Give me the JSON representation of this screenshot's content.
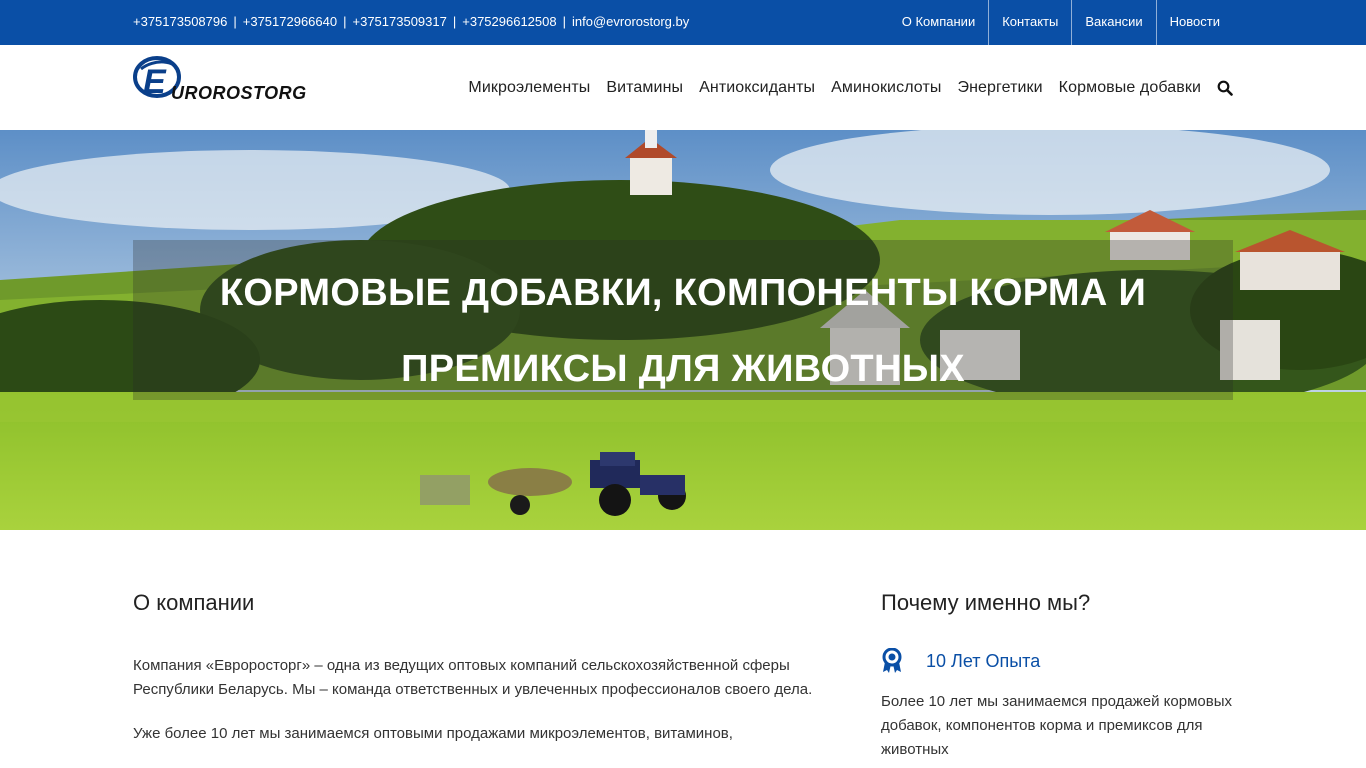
{
  "topbar": {
    "phones": [
      "+375173508796",
      "+375172966640",
      "+375173509317",
      "+375296612508"
    ],
    "email": "info@evrorostorg.by",
    "links": [
      "О Компании",
      "Контакты",
      "Вакансии",
      "Новости"
    ]
  },
  "header": {
    "logo_text": "EUROROSTORG",
    "nav": [
      "Микроэлементы",
      "Витамины",
      "Антиоксиданты",
      "Аминокислоты",
      "Энергетики",
      "Кормовые добавки"
    ]
  },
  "hero": {
    "title_line1": "КОРМОВЫЕ ДОБАВКИ, КОМПОНЕНТЫ КОРМА И",
    "title_line2": "ПРЕМИКСЫ ДЛЯ ЖИВОТНЫХ"
  },
  "about": {
    "heading": "О компании",
    "p1": "Компания «Евроросторг» – одна из ведущих оптовых компаний сельскохозяйственной сферы Республики Беларусь. Мы – команда ответственных и увлеченных профессионалов своего дела.",
    "p2": "Уже более 10 лет мы занимаемся оптовыми продажами микроэлементов, витаминов,"
  },
  "why": {
    "heading": "Почему именно мы?",
    "feature_title": "10 Лет Опыта",
    "feature_text": "Более 10 лет мы занимаемся продажей кормовых добавок, компонентов корма и премиксов для животных"
  },
  "colors": {
    "brand_blue": "#0a4fa6"
  },
  "icons": {
    "search": "search-icon",
    "award": "award-icon"
  }
}
